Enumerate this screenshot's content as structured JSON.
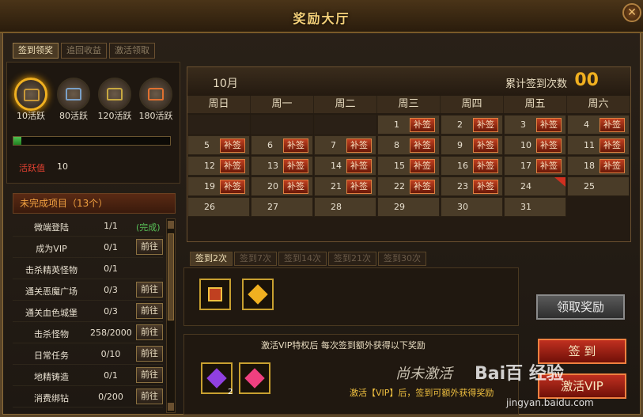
{
  "window": {
    "title": "奖励大厅",
    "close_label": "✕"
  },
  "tabs": [
    {
      "label": "签到领奖",
      "active": true
    },
    {
      "label": "追回收益",
      "active": false
    },
    {
      "label": "激活领取",
      "active": false
    }
  ],
  "chests": [
    {
      "label": "10活跃"
    },
    {
      "label": "80活跃"
    },
    {
      "label": "120活跃"
    },
    {
      "label": "180活跃"
    }
  ],
  "activity": {
    "label": "活跃值",
    "value": "10",
    "progress": 0.05
  },
  "tasks": {
    "header": "未完成项目（13个）",
    "rows": [
      {
        "name": "微端登陆",
        "progress": "1/1",
        "status": "(完成)",
        "button": ""
      },
      {
        "name": "成为VIP",
        "progress": "0/1",
        "status": "",
        "button": "前往"
      },
      {
        "name": "击杀精英怪物",
        "progress": "0/1",
        "status": "",
        "button": ""
      },
      {
        "name": "通关恶魔广场",
        "progress": "0/3",
        "status": "",
        "button": "前往"
      },
      {
        "name": "通关血色城堡",
        "progress": "0/3",
        "status": "",
        "button": "前往"
      },
      {
        "name": "击杀怪物",
        "progress": "258/2000",
        "status": "",
        "button": "前往"
      },
      {
        "name": "日常任务",
        "progress": "0/10",
        "status": "",
        "button": "前往"
      },
      {
        "name": "地精铸造",
        "progress": "0/1",
        "status": "",
        "button": "前往"
      },
      {
        "name": "消费绑钻",
        "progress": "0/200",
        "status": "",
        "button": "前往"
      }
    ]
  },
  "calendar": {
    "month": "10月",
    "cumulative_label": "累计签到次数",
    "cumulative_count": "00",
    "weekdays": [
      "周日",
      "周一",
      "周二",
      "周三",
      "周四",
      "周五",
      "周六"
    ],
    "makeup_label": "补签",
    "days": [
      {
        "n": "1",
        "bq": true
      },
      {
        "n": "2",
        "bq": true
      },
      {
        "n": "3",
        "bq": true
      },
      {
        "n": "4",
        "bq": true
      },
      {
        "n": "5",
        "bq": true
      },
      {
        "n": "6",
        "bq": true
      },
      {
        "n": "7",
        "bq": true
      },
      {
        "n": "8",
        "bq": true
      },
      {
        "n": "9",
        "bq": true
      },
      {
        "n": "10",
        "bq": true
      },
      {
        "n": "11",
        "bq": true
      },
      {
        "n": "12",
        "bq": true
      },
      {
        "n": "13",
        "bq": true
      },
      {
        "n": "14",
        "bq": true
      },
      {
        "n": "15",
        "bq": true
      },
      {
        "n": "16",
        "bq": true
      },
      {
        "n": "17",
        "bq": true
      },
      {
        "n": "18",
        "bq": true
      },
      {
        "n": "19",
        "bq": true
      },
      {
        "n": "20",
        "bq": true
      },
      {
        "n": "21",
        "bq": true
      },
      {
        "n": "22",
        "bq": true
      },
      {
        "n": "23",
        "bq": true
      },
      {
        "n": "24",
        "bq": false,
        "today": true
      },
      {
        "n": "25",
        "bq": false
      },
      {
        "n": "26",
        "bq": false
      },
      {
        "n": "27",
        "bq": false
      },
      {
        "n": "28",
        "bq": false
      },
      {
        "n": "29",
        "bq": false
      },
      {
        "n": "30",
        "bq": false
      },
      {
        "n": "31",
        "bq": false
      }
    ]
  },
  "reward_tabs": [
    {
      "label": "签到2次",
      "active": true
    },
    {
      "label": "签到7次",
      "active": false
    },
    {
      "label": "签到14次",
      "active": false
    },
    {
      "label": "签到21次",
      "active": false
    },
    {
      "label": "签到30次",
      "active": false
    }
  ],
  "buttons": {
    "claim": "领取奖励",
    "signin": "签 到",
    "activate_vip": "激活VIP"
  },
  "vip": {
    "desc": "激活VIP特权后 每次签到额外获得以下奖励",
    "status": "尚未激活",
    "note": "激活【VIP】后，签到可额外获得奖励",
    "gem1_qty": "2"
  },
  "watermark": {
    "logo": "Bai百 经验",
    "url": "jingyan.baidu.com"
  },
  "colors": {
    "accent": "#f0b020",
    "danger": "#c03020",
    "complete": "#58c058"
  }
}
